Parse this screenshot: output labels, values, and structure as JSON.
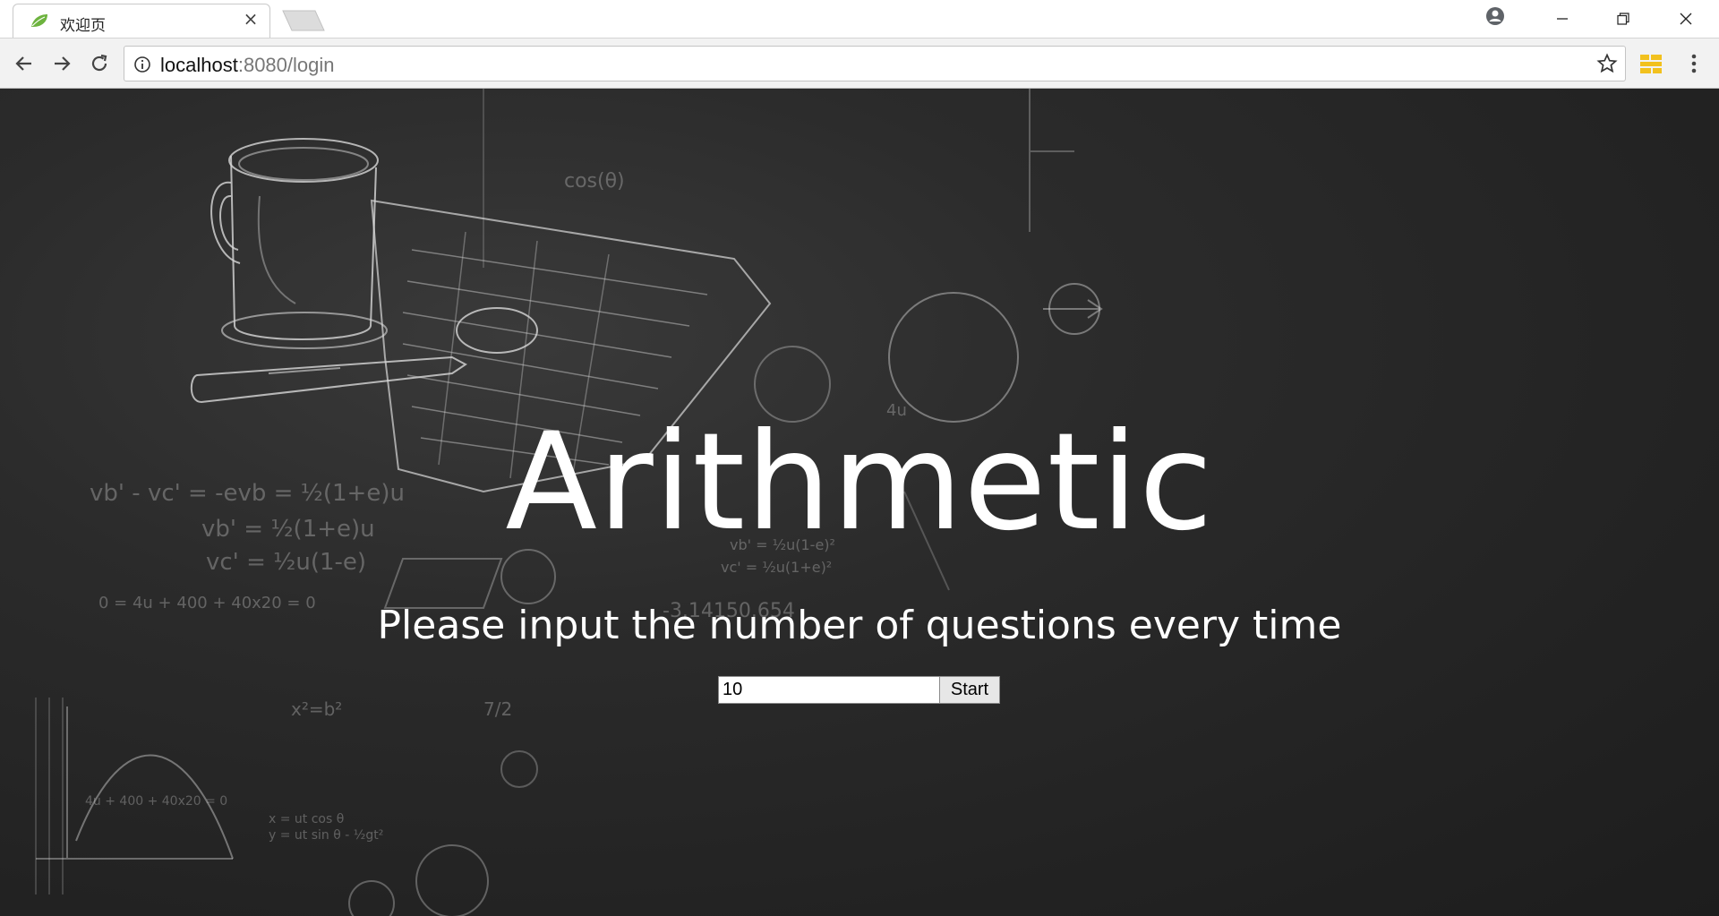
{
  "browser": {
    "tab": {
      "title": "欢迎页",
      "close_glyph": "×",
      "favicon": "leaf-icon"
    },
    "url": {
      "host": "localhost",
      "rest": ":8080/login"
    }
  },
  "page": {
    "title": "Arithmetic",
    "subtitle": "Please input the number of questions every time",
    "form": {
      "input_value": "10",
      "start_label": "Start"
    }
  },
  "colors": {
    "background": "#262626",
    "text": "#ffffff",
    "chrome": "#f2f2f2"
  }
}
